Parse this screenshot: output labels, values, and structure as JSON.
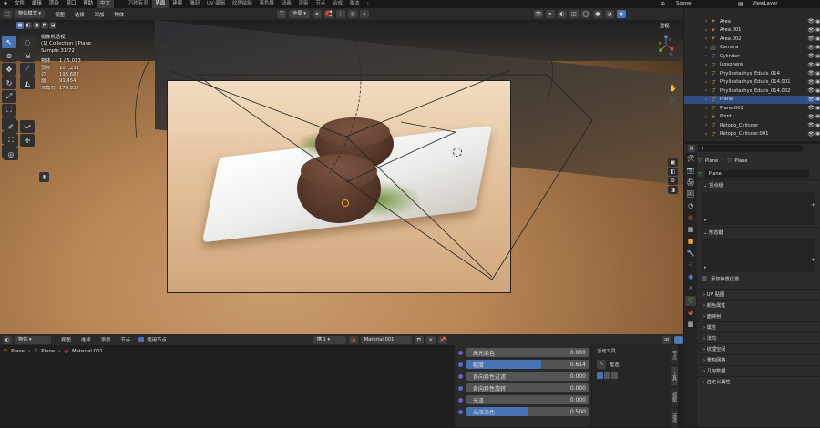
{
  "menu": [
    "文件",
    "编辑",
    "渲染",
    "窗口",
    "帮助",
    "中文"
  ],
  "workspaces": [
    "万物有灵",
    "界面",
    "建模",
    "雕刻",
    "UV 编辑",
    "纹理绘制",
    "着色器",
    "动画",
    "渲染",
    "节点",
    "合成",
    "脚本"
  ],
  "scene": {
    "name": "Scene",
    "view_layer": "ViewLayer"
  },
  "viewport": {
    "mode": "物体模式",
    "menus": [
      "视图",
      "选择",
      "添加",
      "物体"
    ],
    "orientation": "全局",
    "shading": "透视",
    "camera_info": [
      "摄像机透视",
      "(1) Collection | Plane",
      "Sample 31/72"
    ],
    "stats": [
      {
        "k": "物体",
        "v": "1 / 5,013"
      },
      {
        "k": "顶点",
        "v": "107,231"
      },
      {
        "k": "边",
        "v": "195,682"
      },
      {
        "k": "面",
        "v": "91,454"
      },
      {
        "k": "三角形",
        "v": "170,932"
      }
    ]
  },
  "outliner": {
    "items": [
      {
        "name": "Area",
        "icon": "light-icon",
        "color": "#e0a040"
      },
      {
        "name": "Area.001",
        "icon": "light-icon",
        "color": "#e0a040"
      },
      {
        "name": "Area.002",
        "icon": "light-icon",
        "color": "#e0a040"
      },
      {
        "name": "Camera",
        "icon": "camera-icon",
        "color": "#e0a040"
      },
      {
        "name": "Cylinder",
        "icon": "mesh-icon",
        "color": "#888888"
      },
      {
        "name": "Icosphere",
        "icon": "mesh-icon",
        "color": "#e0a040"
      },
      {
        "name": "Phyllostachys_Edulis_014",
        "icon": "mesh-icon",
        "color": "#e0a040"
      },
      {
        "name": "Phyllostachys_Edulis_014.001",
        "icon": "mesh-icon",
        "color": "#e0a040"
      },
      {
        "name": "Phyllostachys_Edulis_014.002",
        "icon": "mesh-icon",
        "color": "#e0a040"
      },
      {
        "name": "Plane",
        "icon": "mesh-icon",
        "color": "#e0a040",
        "selected": true
      },
      {
        "name": "Plane.001",
        "icon": "mesh-icon",
        "color": "#e0a040"
      },
      {
        "name": "Point",
        "icon": "light-icon",
        "color": "#e0a040"
      },
      {
        "name": "Retopo_Cylinder",
        "icon": "mesh-icon",
        "color": "#e0a040"
      },
      {
        "name": "Retopo_Cylinder.001",
        "icon": "mesh-icon",
        "color": "#e0a040"
      }
    ]
  },
  "properties": {
    "breadcrumb": [
      "Plane",
      "Plane"
    ],
    "data_name": "Plane",
    "sections": {
      "vertex_groups": "顶点组",
      "shape_keys": "形态键",
      "add_rest_position": "添加静置位置",
      "collapsed": [
        "UV 贴图",
        "颜色属性",
        "面映射",
        "属性",
        "法向",
        "纹理空间",
        "重构网格",
        "几何数据",
        "自定义属性"
      ]
    }
  },
  "node_editor": {
    "header": {
      "object": "物体",
      "menus": [
        "视图",
        "选择",
        "添加",
        "节点"
      ],
      "use_nodes": "使用节点",
      "slot": "槽 1",
      "material": "Material.001"
    },
    "breadcrumb": [
      "Plane",
      "Plane",
      "Material.001"
    ],
    "rows": [
      {
        "label": "高光染色",
        "value": "0.000",
        "fraction": 0.0
      },
      {
        "label": "糙度",
        "value": "0.614",
        "fraction": 0.614
      },
      {
        "label": "各向异性过滤",
        "value": "0.000",
        "fraction": 0.0
      },
      {
        "label": "各向异性旋转",
        "value": "0.000",
        "fraction": 0.0
      },
      {
        "label": "光泽",
        "value": "0.000",
        "fraction": 0.0
      },
      {
        "label": "光泽染色",
        "value": "0.500",
        "fraction": 0.5
      }
    ],
    "side_panel": {
      "title": "活动工具",
      "tool": "框选"
    },
    "side_tabs": [
      "节点",
      "工具",
      "视图",
      "选项"
    ]
  },
  "colors": {
    "accent": "#4772b3",
    "selected_row": "#334d80",
    "socket": "#6363c7"
  }
}
